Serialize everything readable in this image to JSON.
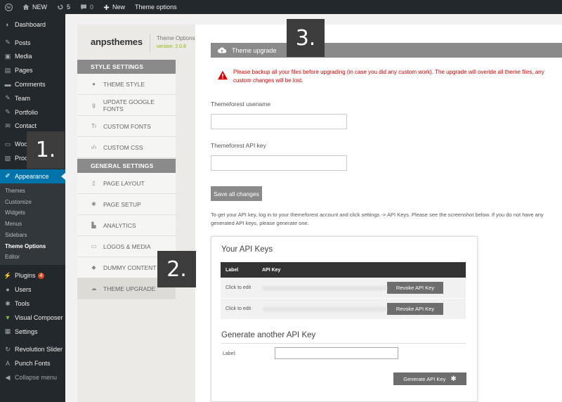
{
  "admin_bar": {
    "site_name": "NEW",
    "updates_count": "5",
    "comments_count": "0",
    "new_label": "New",
    "theme_options_label": "Theme options"
  },
  "sidebar": {
    "items": [
      {
        "label": "Dashboard",
        "icon": "dashboard-icon"
      },
      {
        "label": "Posts",
        "icon": "pin-icon"
      },
      {
        "label": "Media",
        "icon": "media-icon"
      },
      {
        "label": "Pages",
        "icon": "pages-icon"
      },
      {
        "label": "Comments",
        "icon": "comments-icon"
      },
      {
        "label": "Team",
        "icon": "pin-icon"
      },
      {
        "label": "Portfolio",
        "icon": "pin-icon"
      },
      {
        "label": "Contact",
        "icon": "mail-icon"
      },
      {
        "label": "Woo",
        "icon": "woo-icon"
      },
      {
        "label": "Prod",
        "icon": "products-icon"
      },
      {
        "label": "Appearance",
        "icon": "brush-icon"
      }
    ],
    "submenu": [
      "Themes",
      "Customize",
      "Widgets",
      "Menus",
      "Sidebars",
      "Theme Options",
      "Editor"
    ],
    "after_items": [
      {
        "label": "Plugins",
        "icon": "plugin-icon",
        "badge": "4"
      },
      {
        "label": "Users",
        "icon": "users-icon"
      },
      {
        "label": "Tools",
        "icon": "wrench-icon"
      },
      {
        "label": "Visual Composer",
        "icon": "vc-icon"
      },
      {
        "label": "Settings",
        "icon": "settings-icon"
      }
    ],
    "extra_items": [
      {
        "label": "Revolution Slider",
        "icon": "refresh-icon"
      },
      {
        "label": "Punch Fonts",
        "icon": "font-icon"
      },
      {
        "label": "Collapse menu",
        "icon": "collapse-icon"
      }
    ]
  },
  "brand": {
    "logo": "anpsthemes",
    "title": "Theme Options",
    "version": "version: 2.0.8"
  },
  "nav": {
    "style_heading": "STYLE SETTINGS",
    "style_items": [
      {
        "label": "THEME STYLE",
        "icon": "drop-icon"
      },
      {
        "label": "UPDATE GOOGLE FONTS",
        "icon": "google-icon"
      },
      {
        "label": "CUSTOM FONTS",
        "icon": "text-icon"
      },
      {
        "label": "CUSTOM CSS",
        "icon": "code-icon"
      }
    ],
    "general_heading": "GENERAL SETTINGS",
    "general_items": [
      {
        "label": "PAGE LAYOUT",
        "icon": "layout-icon"
      },
      {
        "label": "PAGE SETUP",
        "icon": "gear-icon"
      },
      {
        "label": "ANALYTICS",
        "icon": "chart-icon"
      },
      {
        "label": "LOGOS & MEDIA",
        "icon": "image-icon"
      },
      {
        "label": "DUMMY CONTENT",
        "icon": "dropbox-icon"
      },
      {
        "label": "THEME UPGRADE",
        "icon": "cloud-icon"
      }
    ]
  },
  "upgrade": {
    "bar_title": "Theme upgrade",
    "warning": "Please backup all your files before upgrading (in case you did any custom work). The upgrade will overide all theme files, any custom changes will be lost.",
    "username_label": "Themeforest usename",
    "api_key_label": "Themeforest API key",
    "save_label": "Save all changes",
    "help_text": "To get your API key, log in to your themeforest account and click settings -> API Keys. Please see the screenshot below. If you do not have any generated API keys, please generate one."
  },
  "api_box": {
    "title": "Your API Keys",
    "col_label": "Label",
    "col_key": "API Key",
    "rows": [
      {
        "label": "Click to edit",
        "action": "Revoke API Key"
      },
      {
        "label": "Click to edit",
        "action": "Revoke API Key"
      }
    ],
    "generate_title": "Generate another API Key",
    "generate_label": "Label:",
    "generate_button": "Generate API Key"
  },
  "steps": {
    "one": "1.",
    "two": "2.",
    "three": "3."
  },
  "colors": {
    "admin_dark": "#23282d",
    "admin_active": "#0073aa",
    "section_gray": "#8a8a8a",
    "warning_red": "#dd0000",
    "version_green": "#8cb800"
  }
}
